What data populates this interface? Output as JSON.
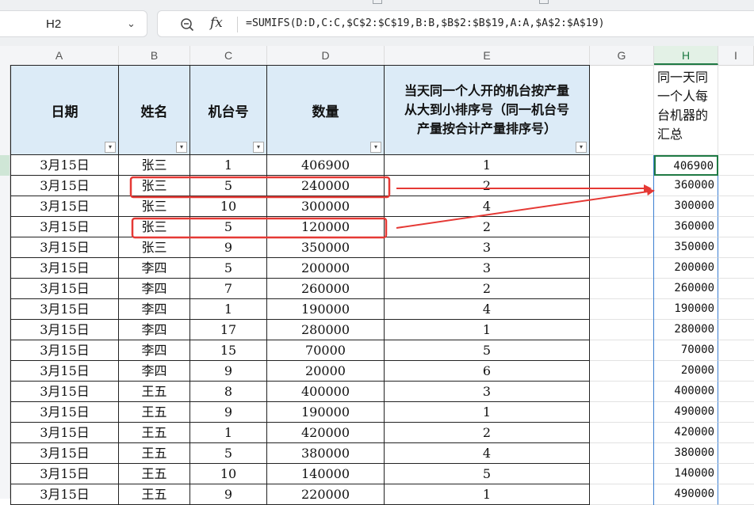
{
  "name_box": {
    "ref": "H2"
  },
  "formula_bar": {
    "formula": "=SUMIFS(D:D,C:C,$C$2:$C$19,B:B,$B$2:$B$19,A:A,$A$2:$A$19)",
    "fx_label": "fx"
  },
  "columns": [
    "A",
    "B",
    "C",
    "D",
    "E",
    "G",
    "H",
    "I"
  ],
  "headers": {
    "date": "日期",
    "name": "姓名",
    "machine": "机台号",
    "qty": "数量",
    "rank_lines": [
      "当天同一个人开的机台按产量",
      "从大到小排序号（同一机台号",
      "产量按合计产量排序号）"
    ],
    "sum_lines": [
      "同一天同",
      "一个人每",
      "台机器的",
      "汇总"
    ]
  },
  "rows": [
    [
      "3月15日",
      "张三",
      "1",
      "406900",
      "1",
      "406900"
    ],
    [
      "3月15日",
      "张三",
      "5",
      "240000",
      "2",
      "360000"
    ],
    [
      "3月15日",
      "张三",
      "10",
      "300000",
      "4",
      "300000"
    ],
    [
      "3月15日",
      "张三",
      "5",
      "120000",
      "2",
      "360000"
    ],
    [
      "3月15日",
      "张三",
      "9",
      "350000",
      "3",
      "350000"
    ],
    [
      "3月15日",
      "李四",
      "5",
      "200000",
      "3",
      "200000"
    ],
    [
      "3月15日",
      "李四",
      "7",
      "260000",
      "2",
      "260000"
    ],
    [
      "3月15日",
      "李四",
      "1",
      "190000",
      "4",
      "190000"
    ],
    [
      "3月15日",
      "李四",
      "17",
      "280000",
      "1",
      "280000"
    ],
    [
      "3月15日",
      "李四",
      "15",
      "70000",
      "5",
      "70000"
    ],
    [
      "3月15日",
      "李四",
      "9",
      "20000",
      "6",
      "20000"
    ],
    [
      "3月15日",
      "王五",
      "8",
      "400000",
      "3",
      "400000"
    ],
    [
      "3月15日",
      "王五",
      "9",
      "190000",
      "1",
      "490000"
    ],
    [
      "3月15日",
      "王五",
      "1",
      "420000",
      "2",
      "420000"
    ],
    [
      "3月15日",
      "王五",
      "5",
      "380000",
      "4",
      "380000"
    ],
    [
      "3月15日",
      "王五",
      "10",
      "140000",
      "5",
      "140000"
    ],
    [
      "3月15日",
      "王五",
      "9",
      "220000",
      "1",
      "490000"
    ]
  ],
  "colors": {
    "header_fill": "#dcebf7",
    "selection_green": "#1f7a44",
    "annotation_red": "#e53935",
    "h_column_border": "#3b7fd1"
  }
}
